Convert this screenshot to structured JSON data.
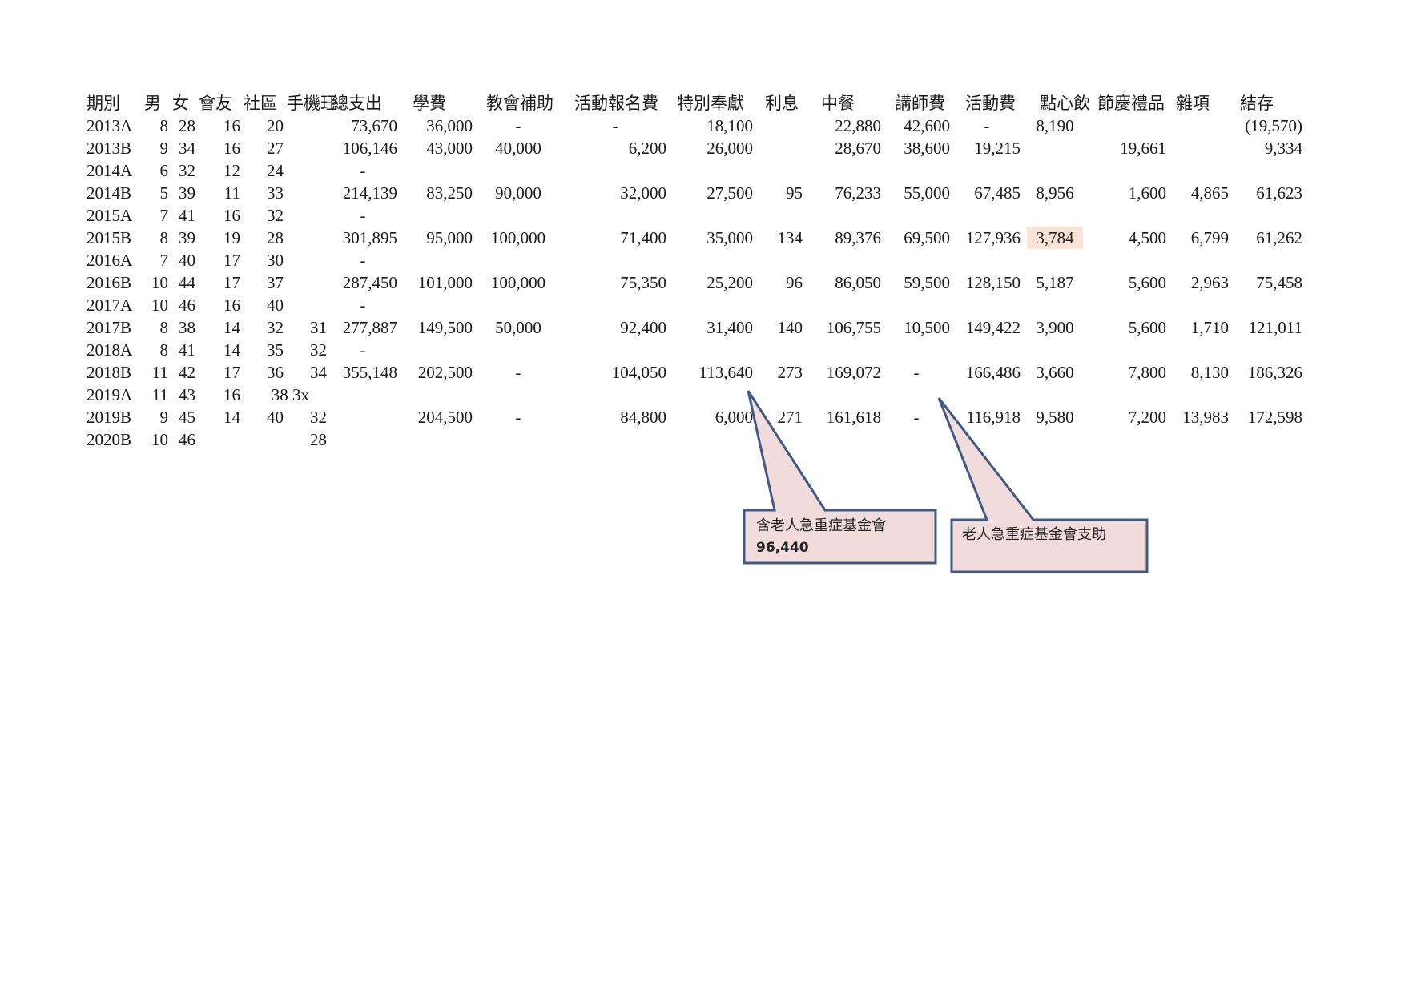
{
  "table": {
    "headers": [
      "期別",
      "男",
      "女",
      "會友",
      "社區",
      "手機玨",
      "總支出",
      "學費",
      "教會補助",
      "活動報名費",
      "特別奉獻",
      "利息",
      "中餐",
      "講師費",
      "活動費",
      "點心飲",
      "節慶禮品",
      "雜項",
      "結存"
    ],
    "rows": [
      [
        "2013A",
        "8",
        "28",
        "16",
        "20",
        "",
        "73,670",
        "36,000",
        "-",
        "-",
        "18,100",
        "",
        "22,880",
        "42,600",
        "-",
        "8,190",
        "",
        "",
        "(19,570)"
      ],
      [
        "2013B",
        "9",
        "34",
        "16",
        "27",
        "",
        "106,146",
        "43,000",
        "40,000",
        "6,200",
        "26,000",
        "",
        "28,670",
        "38,600",
        "19,215",
        "",
        "19,661",
        "",
        "9,334"
      ],
      [
        "2014A",
        "6",
        "32",
        "12",
        "24",
        "",
        "-",
        "",
        "",
        "",
        "",
        "",
        "",
        "",
        "",
        "",
        "",
        "",
        ""
      ],
      [
        "2014B",
        "5",
        "39",
        "11",
        "33",
        "",
        "214,139",
        "83,250",
        "90,000",
        "32,000",
        "27,500",
        "95",
        "76,233",
        "55,000",
        "67,485",
        "8,956",
        "1,600",
        "4,865",
        "61,623"
      ],
      [
        "2015A",
        "7",
        "41",
        "16",
        "32",
        "",
        "-",
        "",
        "",
        "",
        "",
        "",
        "",
        "",
        "",
        "",
        "",
        "",
        ""
      ],
      [
        "2015B",
        "8",
        "39",
        "19",
        "28",
        "",
        "301,895",
        "95,000",
        "100,000",
        "71,400",
        "35,000",
        "134",
        "89,376",
        "69,500",
        "127,936",
        "3,784",
        "4,500",
        "6,799",
        "61,262"
      ],
      [
        "2016A",
        "7",
        "40",
        "17",
        "30",
        "",
        "-",
        "",
        "",
        "",
        "",
        "",
        "",
        "",
        "",
        "",
        "",
        "",
        ""
      ],
      [
        "2016B",
        "10",
        "44",
        "17",
        "37",
        "",
        "287,450",
        "101,000",
        "100,000",
        "75,350",
        "25,200",
        "96",
        "86,050",
        "59,500",
        "128,150",
        "5,187",
        "5,600",
        "2,963",
        "75,458"
      ],
      [
        "2017A",
        "10",
        "46",
        "16",
        "40",
        "",
        "-",
        "",
        "",
        "",
        "",
        "",
        "",
        "",
        "",
        "",
        "",
        "",
        ""
      ],
      [
        "2017B",
        "8",
        "38",
        "14",
        "32",
        "31",
        "277,887",
        "149,500",
        "50,000",
        "92,400",
        "31,400",
        "140",
        "106,755",
        "10,500",
        "149,422",
        "3,900",
        "5,600",
        "1,710",
        "121,011"
      ],
      [
        "2018A",
        "8",
        "41",
        "14",
        "35",
        "32",
        "-",
        "",
        "",
        "",
        "",
        "",
        "",
        "",
        "",
        "",
        "",
        "",
        ""
      ],
      [
        "2018B",
        "11",
        "42",
        "17",
        "36",
        "34",
        "355,148",
        "202,500",
        "-",
        "104,050",
        "113,640",
        "273",
        "169,072",
        "-",
        "166,486",
        "3,660",
        "7,800",
        "8,130",
        "186,326"
      ],
      [
        "2019A",
        "11",
        "43",
        "16",
        "38 3x",
        "",
        "",
        "",
        "",
        "",
        "",
        "",
        "",
        "",
        "",
        "",
        "",
        "",
        ""
      ],
      [
        "2019B",
        "9",
        "45",
        "14",
        "40",
        "32",
        "",
        "204,500",
        "-",
        "84,800",
        "6,000",
        "271",
        "161,618",
        "-",
        "116,918",
        "9,580",
        "7,200",
        "13,983",
        "172,598"
      ],
      [
        "2020B",
        "10",
        "46",
        "",
        "",
        "28",
        "",
        "",
        "",
        "",
        "",
        "",
        "",
        "",
        "",
        "",
        "",
        "",
        ""
      ]
    ],
    "highlight_cell": {
      "row": 5,
      "col": 15,
      "color": "#fbe4d5"
    }
  },
  "callouts": [
    {
      "line1": "含老人急重症基金會",
      "line2": "96,440"
    },
    {
      "line1": "老人急重症基金會支助",
      "line2": ""
    }
  ],
  "colors": {
    "callout_fill": "#f2dcdb",
    "callout_border": "#3f5a85"
  }
}
